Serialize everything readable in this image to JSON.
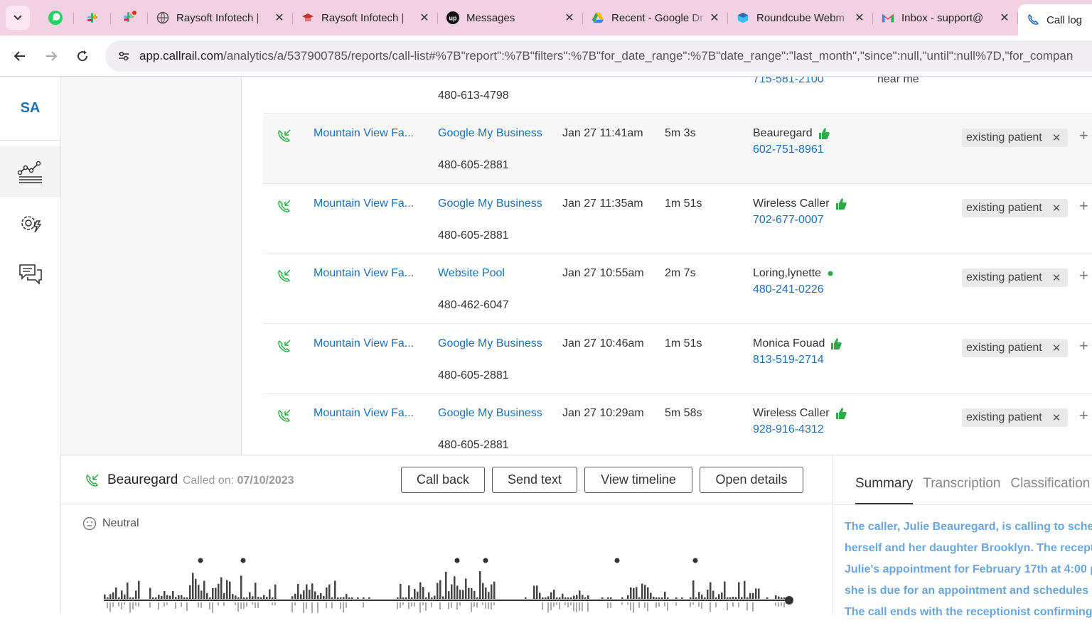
{
  "browser": {
    "tabs": [
      {
        "title": "Raysoft Infotech | ",
        "icon": "globe-icon"
      },
      {
        "title": "Raysoft Infotech | ",
        "icon": "graduation-cap-icon"
      },
      {
        "title": "Messages",
        "icon": "upwork-icon"
      },
      {
        "title": "Recent - Google Dr",
        "icon": "google-drive-icon"
      },
      {
        "title": "Roundcube Webm",
        "icon": "roundcube-icon"
      },
      {
        "title": "Inbox - support@",
        "icon": "gmail-icon"
      },
      {
        "title": "Call log",
        "icon": "phone-icon"
      }
    ],
    "url_host": "app.callrail.com",
    "url_path": "/analytics/a/537900785/reports/call-list#%7B\"report\":%7B\"filters\":%7B\"for_date_range\":%7B\"date_range\":\"last_month\",\"since\":null,\"until\":null%7D,\"for_compan"
  },
  "rail": {
    "initials": "SA"
  },
  "table": {
    "top_row": {
      "tracking_number": "480-613-4798",
      "caller_phone": "715-581-2100",
      "keyword": "near me\""
    },
    "rows": [
      {
        "company": "Mountain View Fa...",
        "source": "Google My Business",
        "tracking_number": "480-605-2881",
        "date": "Jan 27 11:41am",
        "duration": "5m 3s",
        "caller": "Beauregard",
        "mark": "thumbs-up",
        "phone": "602-751-8961",
        "tag": "existing patient"
      },
      {
        "company": "Mountain View Fa...",
        "source": "Google My Business",
        "tracking_number": "480-605-2881",
        "date": "Jan 27 11:35am",
        "duration": "1m 51s",
        "caller": "Wireless Caller",
        "mark": "thumbs-up",
        "phone": "702-677-0007",
        "tag": "existing patient"
      },
      {
        "company": "Mountain View Fa...",
        "source": "Website Pool",
        "tracking_number": "480-462-6047",
        "date": "Jan 27 10:55am",
        "duration": "2m 7s",
        "caller": "Loring,lynette",
        "mark": "dot",
        "phone": "480-241-0226",
        "tag": "existing patient"
      },
      {
        "company": "Mountain View Fa...",
        "source": "Google My Business",
        "tracking_number": "480-605-2881",
        "date": "Jan 27 10:46am",
        "duration": "1m 51s",
        "caller": "Monica Fouad",
        "mark": "thumbs-up",
        "phone": "813-519-2714",
        "tag": "existing patient"
      },
      {
        "company": "Mountain View Fa...",
        "source": "Google My Business",
        "tracking_number": "480-605-2881",
        "date": "Jan 27 10:29am",
        "duration": "5m 58s",
        "caller": "Wireless Caller",
        "mark": "thumbs-up",
        "phone": "928-916-4312",
        "tag": "existing patient"
      }
    ]
  },
  "detail": {
    "caller": "Beauregard",
    "called_on_label": "Called on:",
    "called_on_date": "07/10/2023",
    "buttons": {
      "call_back": "Call back",
      "send_text": "Send text",
      "view_timeline": "View timeline",
      "open_details": "Open details"
    },
    "sentiment": "Neutral",
    "tabs": {
      "summary": "Summary",
      "transcription": "Transcription",
      "classification": "Classification"
    },
    "summary_lines": [
      "The caller, Julie Beauregard, is calling to sched",
      "herself and her daughter Brooklyn. The recepti",
      "Julie's appointment for February 17th at 4:00 p",
      "she is due for an appointment and schedules it",
      "The call ends with the receptionist confirming"
    ]
  },
  "colors": {
    "link": "#1f6fb5",
    "green": "#2eaa4a",
    "tab_strip": "#f2d2e2"
  }
}
